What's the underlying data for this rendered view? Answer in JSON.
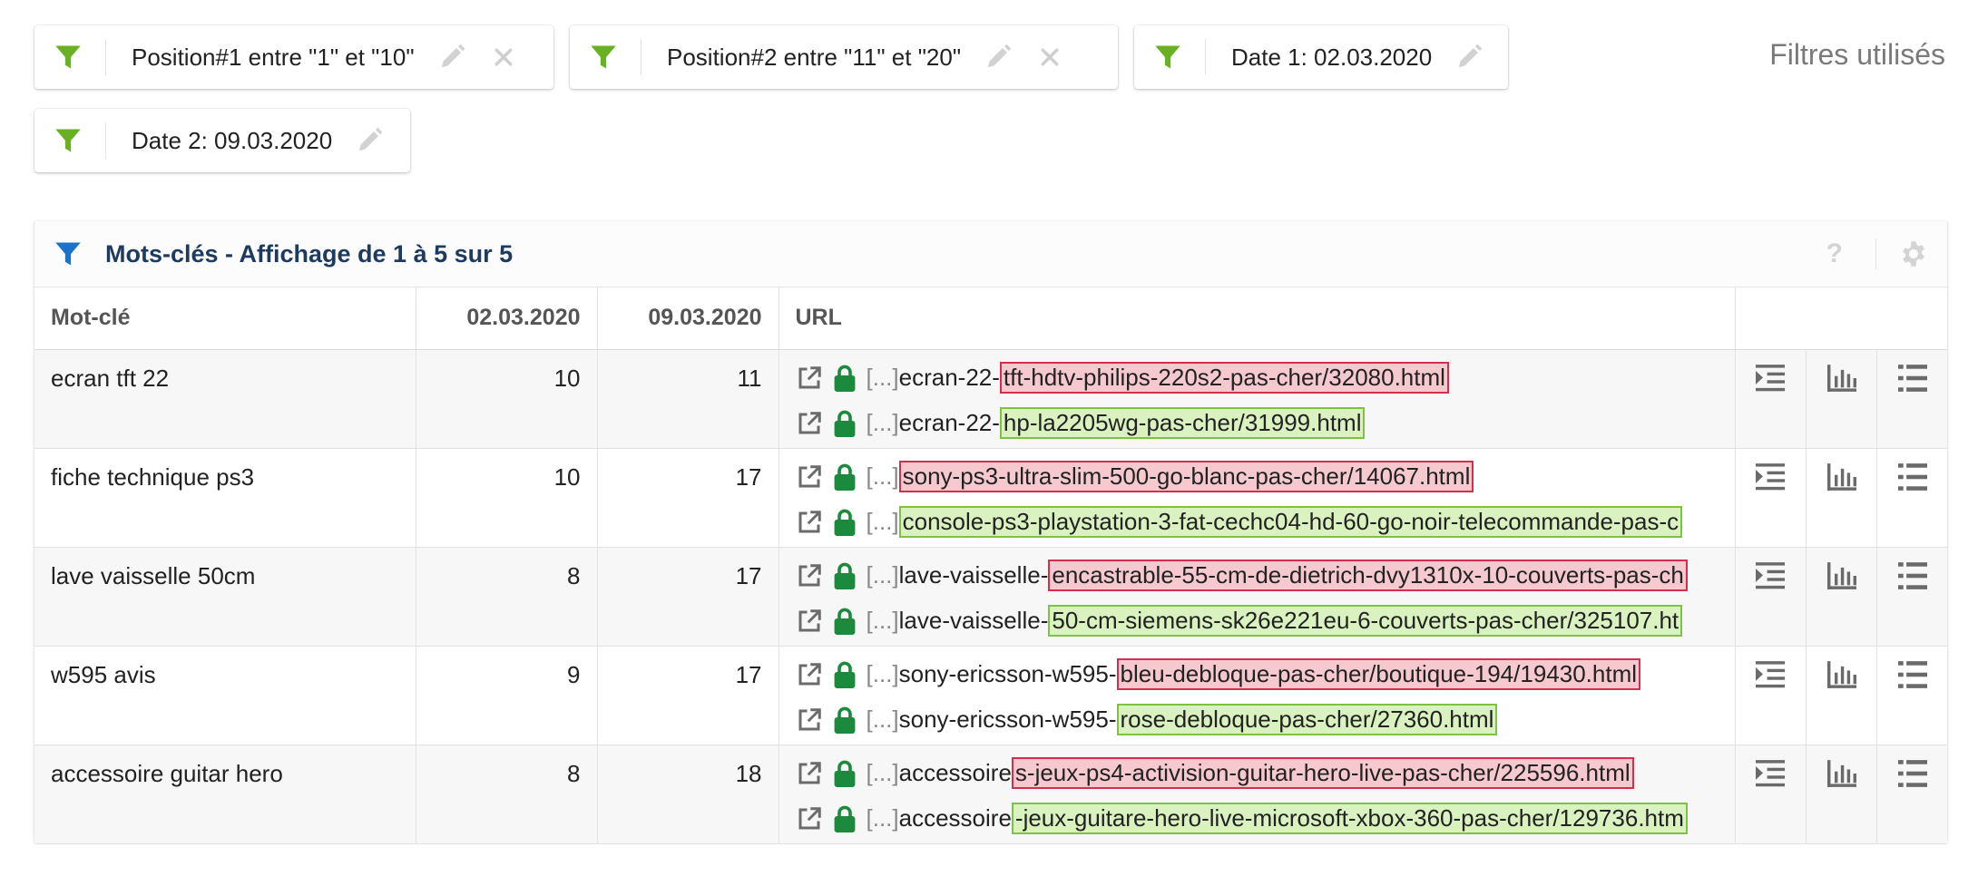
{
  "filters": [
    {
      "label": "Position#1 entre \"1\" et \"10\"",
      "removable": true,
      "icon": "funnel-icon"
    },
    {
      "label": "Position#2 entre \"11\" et \"20\"",
      "removable": true,
      "icon": "funnel-icon"
    },
    {
      "label": "Date 1: 02.03.2020",
      "removable": false,
      "icon": "funnel-icon"
    },
    {
      "label": "Date 2: 09.03.2020",
      "removable": false,
      "icon": "funnel-icon"
    }
  ],
  "filters_title": "Filtres utilisés",
  "panel": {
    "title": "Mots-clés - Affichage de 1 à 5 sur 5",
    "help": "?",
    "columns": {
      "keyword": "Mot-clé",
      "date1": "02.03.2020",
      "date2": "09.03.2020",
      "url": "URL"
    },
    "rows": [
      {
        "keyword": "ecran tft 22",
        "pos1": "10",
        "pos2": "11",
        "url1_base": "ecran-22-",
        "url1_diff": "tft-hdtv-philips-220s2-pas-cher/32080.html",
        "url2_base": "ecran-22-",
        "url2_diff": "hp-la2205wg-pas-cher/31999.html"
      },
      {
        "keyword": "fiche technique ps3",
        "pos1": "10",
        "pos2": "17",
        "url1_base": "",
        "url1_diff": "sony-ps3-ultra-slim-500-go-blanc-pas-cher/14067.html",
        "url2_base": "",
        "url2_diff": "console-ps3-playstation-3-fat-cechc04-hd-60-go-noir-telecommande-pas-c"
      },
      {
        "keyword": "lave vaisselle 50cm",
        "pos1": "8",
        "pos2": "17",
        "url1_base": "lave-vaisselle-",
        "url1_diff": "encastrable-55-cm-de-dietrich-dvy1310x-10-couverts-pas-ch",
        "url2_base": "lave-vaisselle-",
        "url2_diff": "50-cm-siemens-sk26e221eu-6-couverts-pas-cher/325107.ht"
      },
      {
        "keyword": "w595 avis",
        "pos1": "9",
        "pos2": "17",
        "url1_base": "sony-ericsson-w595-",
        "url1_diff": "bleu-debloque-pas-cher/boutique-194/19430.html",
        "url2_base": "sony-ericsson-w595-",
        "url2_diff": "rose-debloque-pas-cher/27360.html"
      },
      {
        "keyword": "accessoire guitar hero",
        "pos1": "8",
        "pos2": "18",
        "url1_base": "accessoire",
        "url1_diff": "s-jeux-ps4-activision-guitar-hero-live-pas-cher/225596.html",
        "url2_base": "accessoire",
        "url2_diff": "-jeux-guitare-hero-live-microsoft-xbox-360-pas-cher/129736.htm"
      }
    ],
    "url_prefix": "[...]"
  },
  "colors": {
    "funnel_green": "#6ab023",
    "funnel_blue": "#1a73c8",
    "lock_green": "#1c8a3c",
    "red_border": "#d32f4c",
    "green_border": "#7dc243",
    "title_navy": "#1e3a5f"
  }
}
